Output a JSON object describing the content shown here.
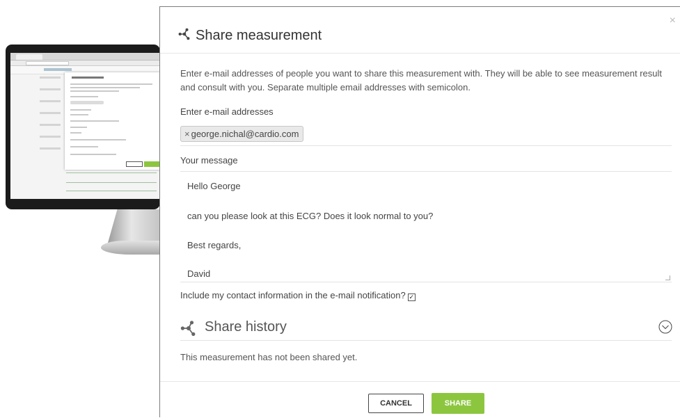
{
  "modal": {
    "title": "Share measurement",
    "close_symbol": "×",
    "title_icon": "share-network-icon",
    "intro": "Enter e-mail addresses of people you want to share this measurement with. They will be able to see measurement result and consult with you. Separate multiple email addresses with semicolon.",
    "emails_label": "Enter e-mail addresses",
    "emails": [
      {
        "remove_symbol": "×",
        "address": "george.nichal@cardio.com"
      }
    ],
    "message_label": "Your message",
    "message_lines": [
      "Hello George",
      "can you please look at this ECG? Does it look normal to you?",
      "Best regards,",
      "David"
    ],
    "contact_label": "Include my contact information in the e-mail notification?",
    "contact_checked": true,
    "history": {
      "title": "Share history",
      "icon": "share-network-icon",
      "expand_icon": "chevron-down-circle-icon",
      "empty_text": "This measurement has not been shared yet."
    },
    "buttons": {
      "cancel": "CANCEL",
      "share": "SHARE"
    }
  },
  "colors": {
    "accent": "#8cc63f",
    "chip_bg": "#e9e9e9",
    "text": "#444444"
  }
}
